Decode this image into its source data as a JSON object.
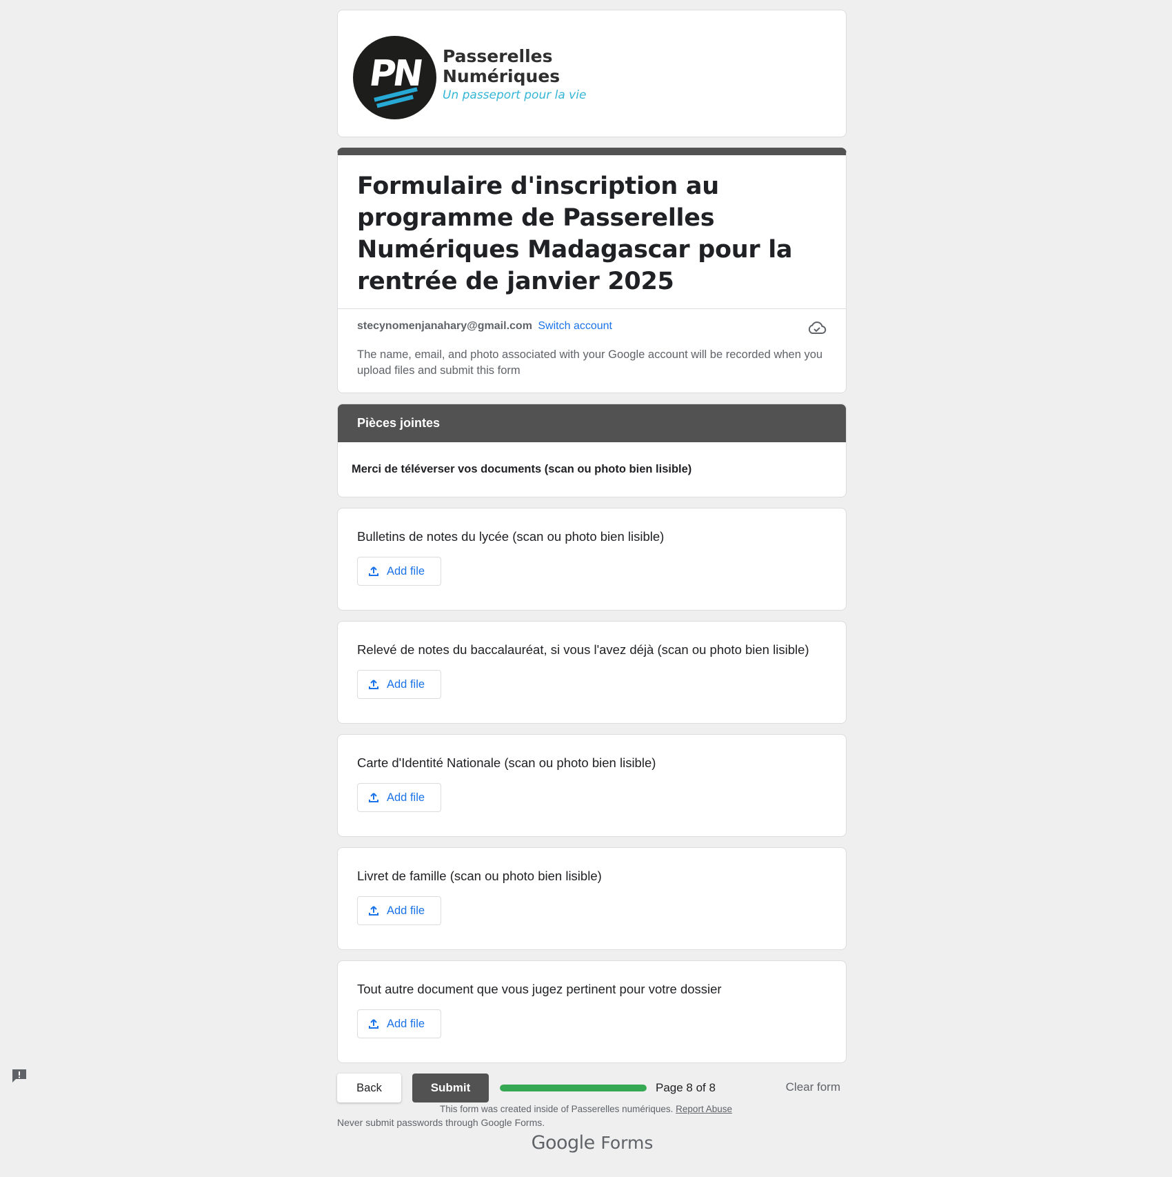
{
  "logo": {
    "mark": "PN",
    "name_line1": "Passerelles",
    "name_line2": "Numériques",
    "tagline": "Un passeport pour la vie"
  },
  "form": {
    "title": "Formulaire d'inscription au programme de Passerelles Numériques Madagascar pour la rentrée de janvier 2025",
    "account_email": "stecynomenjanahary@gmail.com",
    "switch_account": "Switch account",
    "notice": "The name, email, and photo associated with your Google account will be recorded when you upload files and submit this form"
  },
  "section": {
    "title": "Pièces jointes",
    "description": "Merci de téléverser vos documents (scan ou photo bien lisible)"
  },
  "questions": [
    {
      "label": "Bulletins de notes du lycée (scan ou photo bien lisible)",
      "button": "Add file"
    },
    {
      "label": "Relevé de notes du baccalauréat, si vous l'avez déjà (scan ou photo bien lisible)",
      "button": "Add file"
    },
    {
      "label": "Carte d'Identité Nationale (scan ou photo bien lisible)",
      "button": "Add file"
    },
    {
      "label": "Livret de famille (scan ou photo bien lisible)",
      "button": "Add file"
    },
    {
      "label": "Tout autre document que vous jugez pertinent pour votre dossier",
      "button": "Add file"
    }
  ],
  "nav": {
    "back": "Back",
    "submit": "Submit",
    "page_label": "Page 8 of 8",
    "progress_fraction": 1.0,
    "clear_form": "Clear form"
  },
  "footer": {
    "password_warning": "Never submit passwords through Google Forms.",
    "created_inside": "This form was created inside of Passerelles numériques.",
    "report_abuse": "Report Abuse",
    "brand_google": "Google",
    "brand_forms": "Forms"
  },
  "colors": {
    "theme": "#525252",
    "link": "#1a73e8",
    "progress": "#34a853",
    "background": "#efefef"
  },
  "icons": [
    "cloud-check-icon",
    "upload-icon",
    "report-issue-icon"
  ]
}
